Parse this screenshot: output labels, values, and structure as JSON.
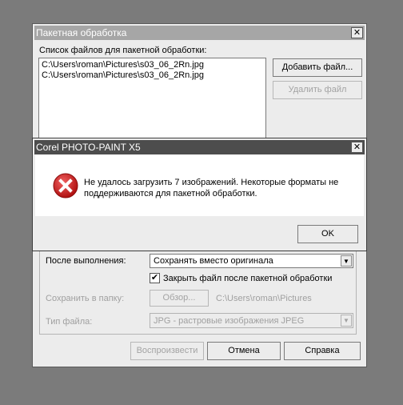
{
  "batch": {
    "title": "Пакетная обработка",
    "close_glyph": "✕",
    "files_label": "Список файлов для пакетной обработки:",
    "files": [
      "C:\\Users\\roman\\Pictures\\s03_06_2Rn.jpg",
      "C:\\Users\\roman\\Pictures\\s03_06_2Rn.jpg"
    ],
    "add_file": "Добавить файл...",
    "remove_file": "Удалить файл",
    "after_label": "После выполнения:",
    "after_value": "Сохранять вместо оригинала",
    "close_after_label": "Закрыть файл после пакетной обработки",
    "close_after_checked": true,
    "save_to_label": "Сохранить в папку:",
    "browse": "Обзор...",
    "save_path": "C:\\Users\\roman\\Pictures",
    "file_type_label": "Тип файла:",
    "file_type_value": "JPG - растровые изображения JPEG",
    "play": "Воспроизвести",
    "cancel": "Отмена",
    "help": "Справка"
  },
  "alert": {
    "title": "Corel PHOTO-PAINT X5",
    "close_glyph": "✕",
    "message": "Не удалось загрузить 7 изображений. Некоторые форматы не поддерживаются для пакетной обработки.",
    "ok": "OK",
    "icon": "error-icon",
    "icon_color": "#cc1f1f"
  }
}
